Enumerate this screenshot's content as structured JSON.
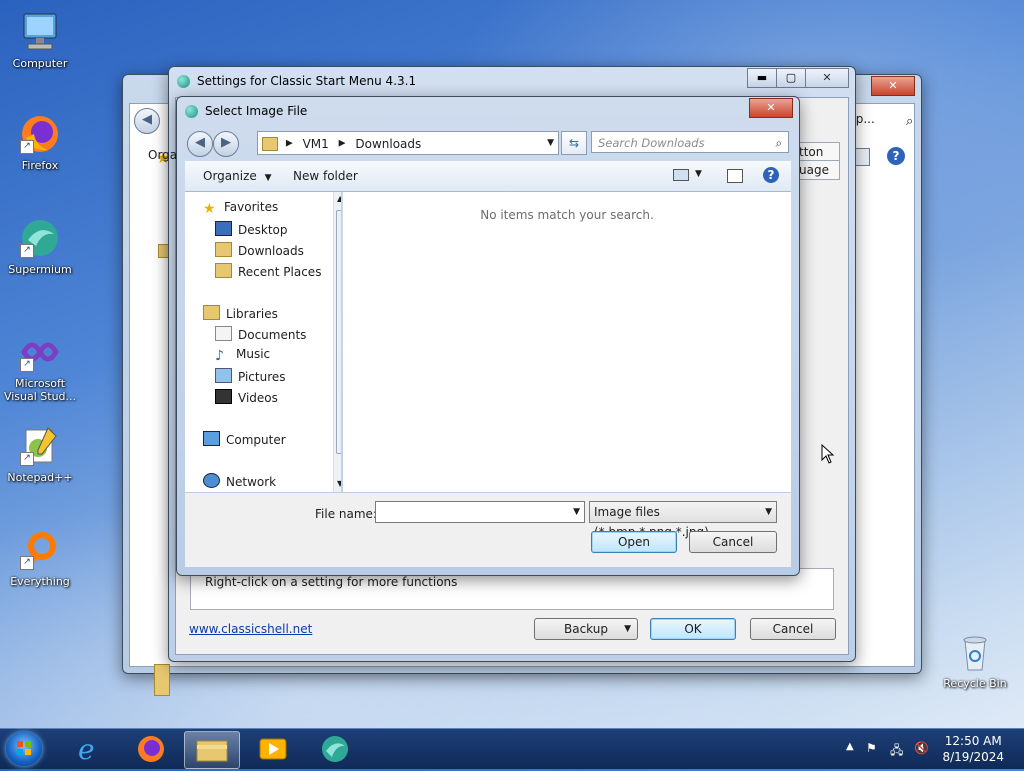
{
  "desktop": {
    "icons": [
      {
        "label": "Computer",
        "shortcut": false
      },
      {
        "label": "Firefox",
        "shortcut": true
      },
      {
        "label": "Supermium",
        "shortcut": true
      },
      {
        "label": "Microsoft Visual Stud...",
        "shortcut": true
      },
      {
        "label": "Notepad++",
        "shortcut": true
      },
      {
        "label": "Everything",
        "shortcut": true
      },
      {
        "label": "Recycle Bin",
        "shortcut": false
      }
    ]
  },
  "back_window": {
    "search_fragment": "",
    "help_link": "elp..."
  },
  "settings_window": {
    "title": "Settings for Classic Start Menu 4.3.1",
    "partial_toolbar": "Orga",
    "partial_tab1": "tton",
    "partial_tab2": "uage",
    "hint": "Right-click on a setting for more functions",
    "website": "www.classicshell.net",
    "backup_label": "Backup",
    "ok_label": "OK",
    "cancel_label": "Cancel"
  },
  "dialog": {
    "title": "Select Image File",
    "breadcrumb": [
      "VM1",
      "Downloads"
    ],
    "search_placeholder": "Search Downloads",
    "organize_label": "Organize",
    "new_folder_label": "New folder",
    "empty_message": "No items match your search.",
    "nav": {
      "favorites": "Favorites",
      "desktop": "Desktop",
      "downloads": "Downloads",
      "recent": "Recent Places",
      "libraries": "Libraries",
      "documents": "Documents",
      "music": "Music",
      "pictures": "Pictures",
      "videos": "Videos",
      "computer": "Computer",
      "network": "Network"
    },
    "filename_label": "File name:",
    "filename_value": "",
    "filetype": "Image files (*.bmp,*.png,*.jpg)",
    "open_label": "Open",
    "cancel_label": "Cancel"
  },
  "taskbar": {
    "time": "12:50 AM",
    "date": "8/19/2024"
  },
  "colors": {
    "taskbar": "#173768",
    "accent": "#3c7fb1",
    "close_button": "#c9442c"
  }
}
